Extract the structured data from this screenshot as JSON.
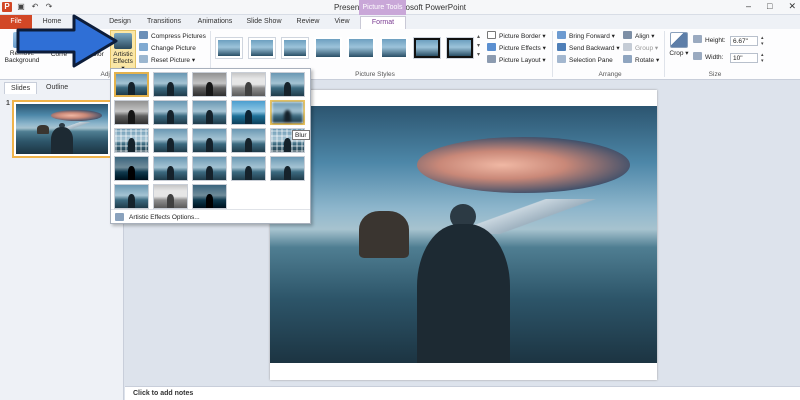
{
  "window": {
    "title": "Presentation1 - Microsoft PowerPoint",
    "context_tab_group": "Picture Tools"
  },
  "tabs": [
    {
      "label": "File"
    },
    {
      "label": "Home"
    },
    {
      "label": "Design"
    },
    {
      "label": "Transitions"
    },
    {
      "label": "Animations"
    },
    {
      "label": "Slide Show"
    },
    {
      "label": "Review"
    },
    {
      "label": "View"
    },
    {
      "label": "Format"
    }
  ],
  "ribbon": {
    "adjust": {
      "remove_background": "Remove Background",
      "corrections": "Corre",
      "color": "Color",
      "artistic_effects": "Artistic Effects",
      "compress": "Compress Pictures",
      "change": "Change Picture",
      "reset": "Reset Picture",
      "group_label": "Adju"
    },
    "picture_styles": {
      "group_label": "Picture Styles",
      "border": "Picture Border",
      "effects": "Picture Effects",
      "layout": "Picture Layout"
    },
    "arrange": {
      "group_label": "Arrange",
      "bring_forward": "Bring Forward",
      "send_backward": "Send Backward",
      "selection_pane": "Selection Pane",
      "align": "Align",
      "group": "Group",
      "rotate": "Rotate"
    },
    "size": {
      "group_label": "Size",
      "crop": "Crop",
      "height_label": "Height:",
      "height_value": "6.67\"",
      "width_label": "Width:",
      "width_value": "10\""
    }
  },
  "left_panel": {
    "tab_slides": "Slides",
    "tab_outline": "Outline",
    "slide_number": "1"
  },
  "gallery": {
    "footer": "Artistic Effects Options...",
    "tooltip": "Blur",
    "selected_index": 0,
    "hover_index": 9
  },
  "notes": {
    "placeholder": "Click to add notes"
  },
  "colors": {
    "file_tab": "#d24726",
    "context_tab": "#c9a7d8",
    "arrow": "#2f6fd6",
    "selection": "#e3b24d"
  }
}
